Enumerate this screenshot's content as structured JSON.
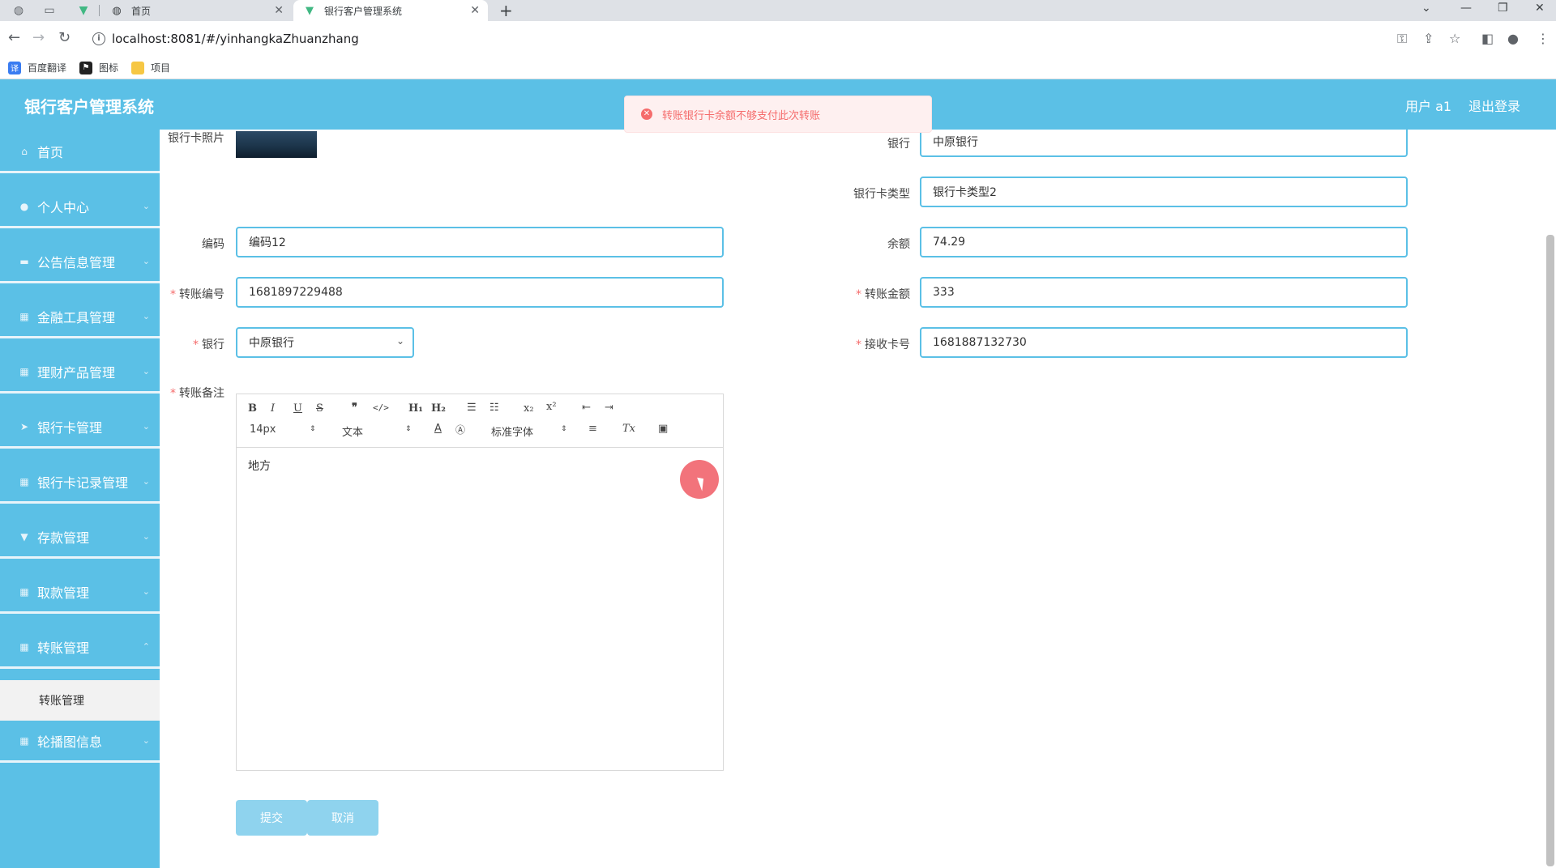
{
  "browser": {
    "tabs": [
      {
        "label": "首页",
        "icon": "globe-icon"
      },
      {
        "label": "银行客户管理系统",
        "icon": "vue-logo-icon"
      }
    ],
    "url": "localhost:8081/#/yinhangkaZhuanzhang",
    "bookmarks": [
      {
        "label": "百度翻译",
        "color": "#3a7cf1"
      },
      {
        "label": "图标",
        "color": "#222222"
      },
      {
        "label": "项目",
        "color": "#f6c744"
      }
    ]
  },
  "header": {
    "title": "银行客户管理系统",
    "user": "用户 a1",
    "logout": "退出登录"
  },
  "toast": {
    "message": "转账银行卡余额不够支付此次转账",
    "type": "error"
  },
  "sidebar": {
    "items": [
      {
        "label": "首页",
        "icon": "home-icon"
      },
      {
        "label": "个人中心",
        "icon": "user-icon"
      },
      {
        "label": "公告信息管理",
        "icon": "notice-icon"
      },
      {
        "label": "金融工具管理",
        "icon": "grid-icon"
      },
      {
        "label": "理财产品管理",
        "icon": "grid-icon"
      },
      {
        "label": "银行卡管理",
        "icon": "send-icon"
      },
      {
        "label": "银行卡记录管理",
        "icon": "grid-icon"
      },
      {
        "label": "存款管理",
        "icon": "funnel-icon"
      },
      {
        "label": "取款管理",
        "icon": "grid-icon"
      },
      {
        "label": "转账管理",
        "icon": "grid-icon"
      },
      {
        "label": "轮播图信息",
        "icon": "grid-icon"
      }
    ],
    "submenu": {
      "label": "转账管理"
    }
  },
  "form": {
    "card_photo": {
      "label": "银行卡照片"
    },
    "bank_top": {
      "label": "银行",
      "value": "中原银行"
    },
    "card_type": {
      "label": "银行卡类型",
      "value": "银行卡类型2"
    },
    "code": {
      "label": "编码",
      "value": "编码12"
    },
    "balance": {
      "label": "余额",
      "value": "74.29"
    },
    "transfer_no": {
      "label": "转账编号",
      "value": "1681897229488"
    },
    "transfer_amount": {
      "label": "转账金额",
      "value": "333"
    },
    "bank": {
      "label": "银行",
      "value": "中原银行"
    },
    "receive_card": {
      "label": "接收卡号",
      "value": "1681887132730"
    },
    "remark": {
      "label": "转账备注",
      "value": "地方"
    }
  },
  "editor_toolbar": {
    "font_size": "14px",
    "header": "文本",
    "font_family": "标准字体"
  },
  "buttons": {
    "submit": "提交",
    "cancel": "取消"
  },
  "colors": {
    "primary": "#5bc0e6",
    "error": "#f56c6c",
    "button": "#8fd3ee"
  }
}
